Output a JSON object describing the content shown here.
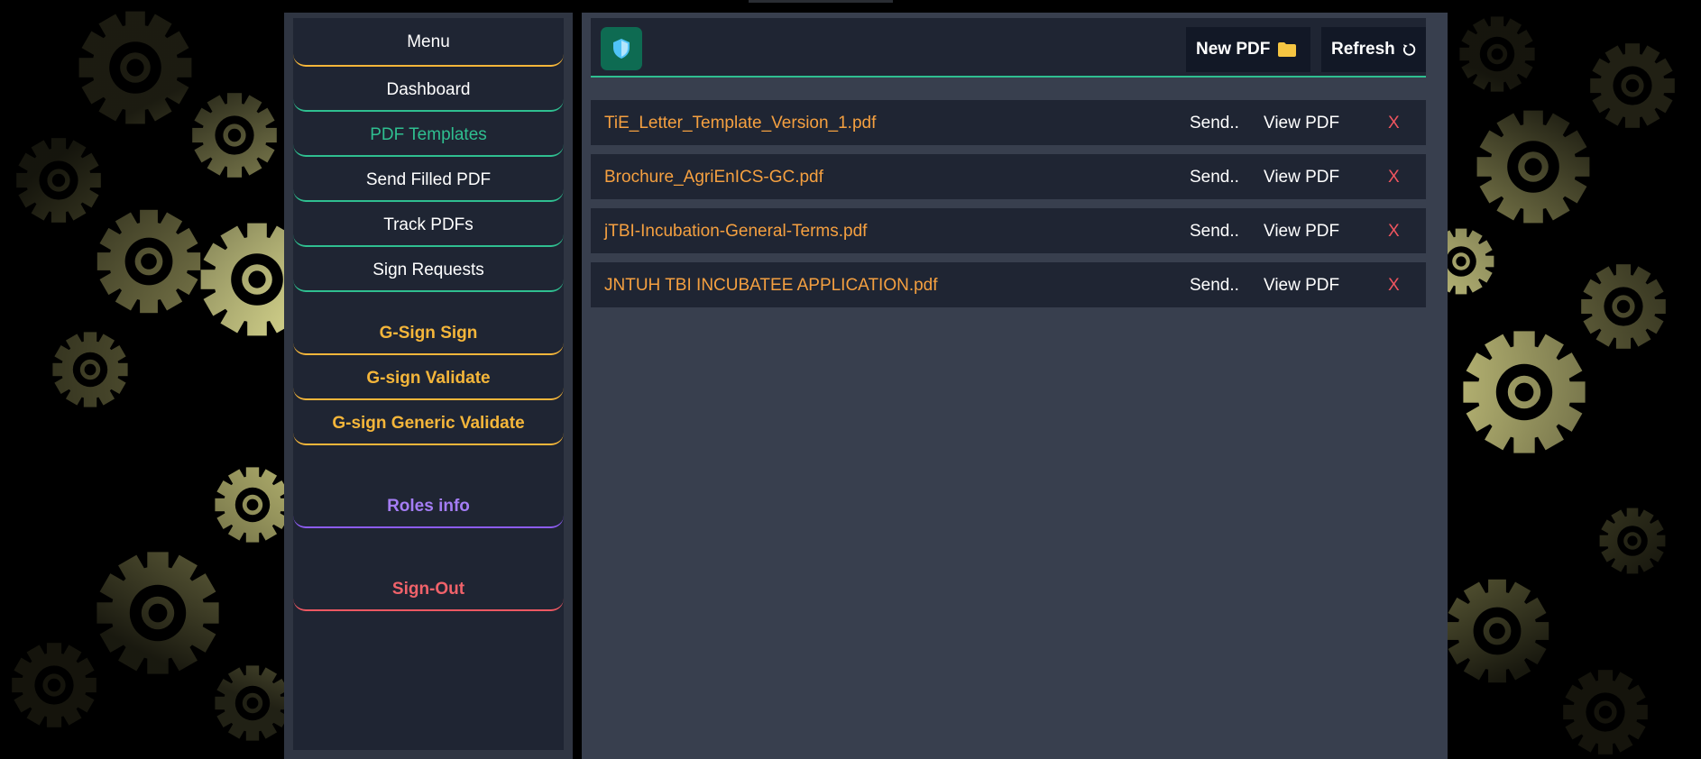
{
  "sidebar": {
    "title": "Menu",
    "items": [
      {
        "label": "Dashboard"
      },
      {
        "label": "PDF Templates"
      },
      {
        "label": "Send Filled PDF"
      },
      {
        "label": "Track PDFs"
      },
      {
        "label": "Sign Requests"
      }
    ],
    "gsign": [
      {
        "label": "G-Sign Sign"
      },
      {
        "label": "G-sign Validate"
      },
      {
        "label": "G-sign Generic Validate"
      }
    ],
    "roles_label": "Roles info",
    "signout_label": "Sign-Out"
  },
  "header": {
    "logo_icon": "shield-icon",
    "new_pdf_label": "New PDF",
    "new_pdf_icon": "folder-icon",
    "refresh_label": "Refresh",
    "refresh_icon": "refresh-icon"
  },
  "files": [
    {
      "name": "TiE_Letter_Template_Version_1.pdf",
      "send": "Send..",
      "view": "View PDF",
      "delete": "X"
    },
    {
      "name": "Brochure_AgriEnICS-GC.pdf",
      "send": "Send..",
      "view": "View PDF",
      "delete": "X"
    },
    {
      "name": "jTBI-Incubation-General-Terms.pdf",
      "send": "Send..",
      "view": "View PDF",
      "delete": "X"
    },
    {
      "name": "JNTUH TBI INCUBATEE APPLICATION.pdf",
      "send": "Send..",
      "view": "View PDF",
      "delete": "X"
    }
  ],
  "colors": {
    "accent_green": "#2fbf90",
    "accent_gold": "#f5b63a",
    "accent_purple": "#8c5cf0",
    "danger_red": "#f0555f",
    "file_orange": "#f5a040"
  }
}
